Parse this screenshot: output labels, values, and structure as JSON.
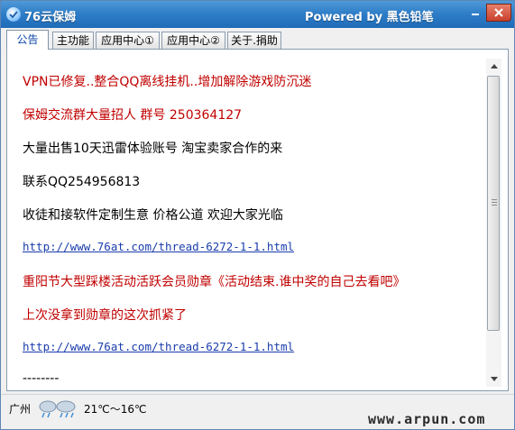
{
  "window": {
    "title": "76云保姆",
    "powered": "Powered by 黑色铅笔"
  },
  "tabs": [
    {
      "label": "公告",
      "active": true
    },
    {
      "label": "主功能",
      "active": false
    },
    {
      "label": "应用中心①",
      "active": false
    },
    {
      "label": "应用中心②",
      "active": false
    },
    {
      "label": "关于.捐助",
      "active": false
    }
  ],
  "notice": {
    "lines": [
      {
        "text": "VPN已修复..整合QQ离线挂机..增加解除游戏防沉迷",
        "style": "red"
      },
      {
        "text": "保姆交流群大量招人 群号 250364127",
        "style": "red"
      },
      {
        "text": "大量出售10天迅雷体验账号 淘宝卖家合作的来",
        "style": "black"
      },
      {
        "text": "联系QQ254956813",
        "style": "black"
      },
      {
        "text": "收徒和接软件定制生意 价格公道 欢迎大家光临",
        "style": "black"
      },
      {
        "text": "http://www.76at.com/thread-6272-1-1.html",
        "style": "link"
      },
      {
        "text": "重阳节大型踩楼活动活跃会员勋章《活动结束.谁中奖的自己去看吧》",
        "style": "red"
      },
      {
        "text": "上次没拿到勋章的这次抓紧了",
        "style": "red"
      },
      {
        "text": "http://www.76at.com/thread-6272-1-1.html",
        "style": "link"
      },
      {
        "text": "--------",
        "style": "black"
      }
    ]
  },
  "status": {
    "city": "广州",
    "weather_icon": "rain-cloud-icon",
    "temperature": "21℃～16℃",
    "watermark": "www.arpun.com"
  },
  "colors": {
    "titlebar": "#2f7ec8",
    "red_text": "#c00000",
    "link": "#1a3dab"
  }
}
